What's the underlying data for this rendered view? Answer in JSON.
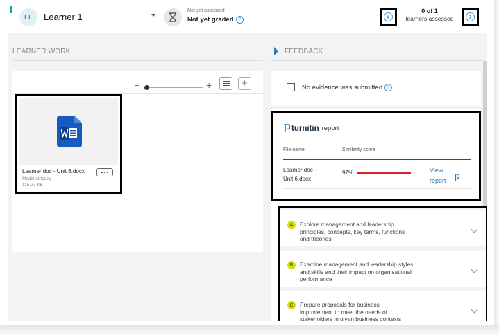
{
  "header": {
    "avatar_initials": "LL",
    "learner_name": "Learner 1",
    "assessment_status": "Not yet assessed",
    "grade_status": "Not yet graded",
    "assessed_count": "0 of 1",
    "assessed_label": "learners assessed"
  },
  "learner_work": {
    "title": "LEARNER WORK",
    "file": {
      "name": "Learner doc - Unit 6.docx",
      "modified": "Modified today",
      "size": "115.27 KB"
    }
  },
  "feedback": {
    "title": "FEEDBACK",
    "no_evidence_label": "No evidence was submitted",
    "no_evidence_checked": false,
    "turnitin": {
      "brand": "turnitin",
      "report_label": "report",
      "col_file_name": "File name",
      "col_similarity": "Similarity score",
      "file_line1": "Learner doc -",
      "file_line2": "Unit 6.docx",
      "similarity": "97%",
      "similarity_fraction": 0.97,
      "view_line1": "View",
      "view_line2": "report",
      "bar_color": "#d81f26"
    },
    "criteria": [
      {
        "badge": "A",
        "line1": "Explore management and leadership",
        "line2": "principles, concepts, key terms, functions",
        "line3": "and theories"
      },
      {
        "badge": "B",
        "line1": "Examine management and leadership styles",
        "line2": "and skills and their impact on organisational",
        "line3": "performance"
      },
      {
        "badge": "C",
        "line1": "Prepare proposals for business",
        "line2": "improvement to meet the needs of",
        "line3": "stakeholders in given business contexts"
      }
    ]
  },
  "colors": {
    "accent_blue": "#2a7ab8",
    "badge_yellow": "#d4e100",
    "word_blue": "#185abd"
  }
}
